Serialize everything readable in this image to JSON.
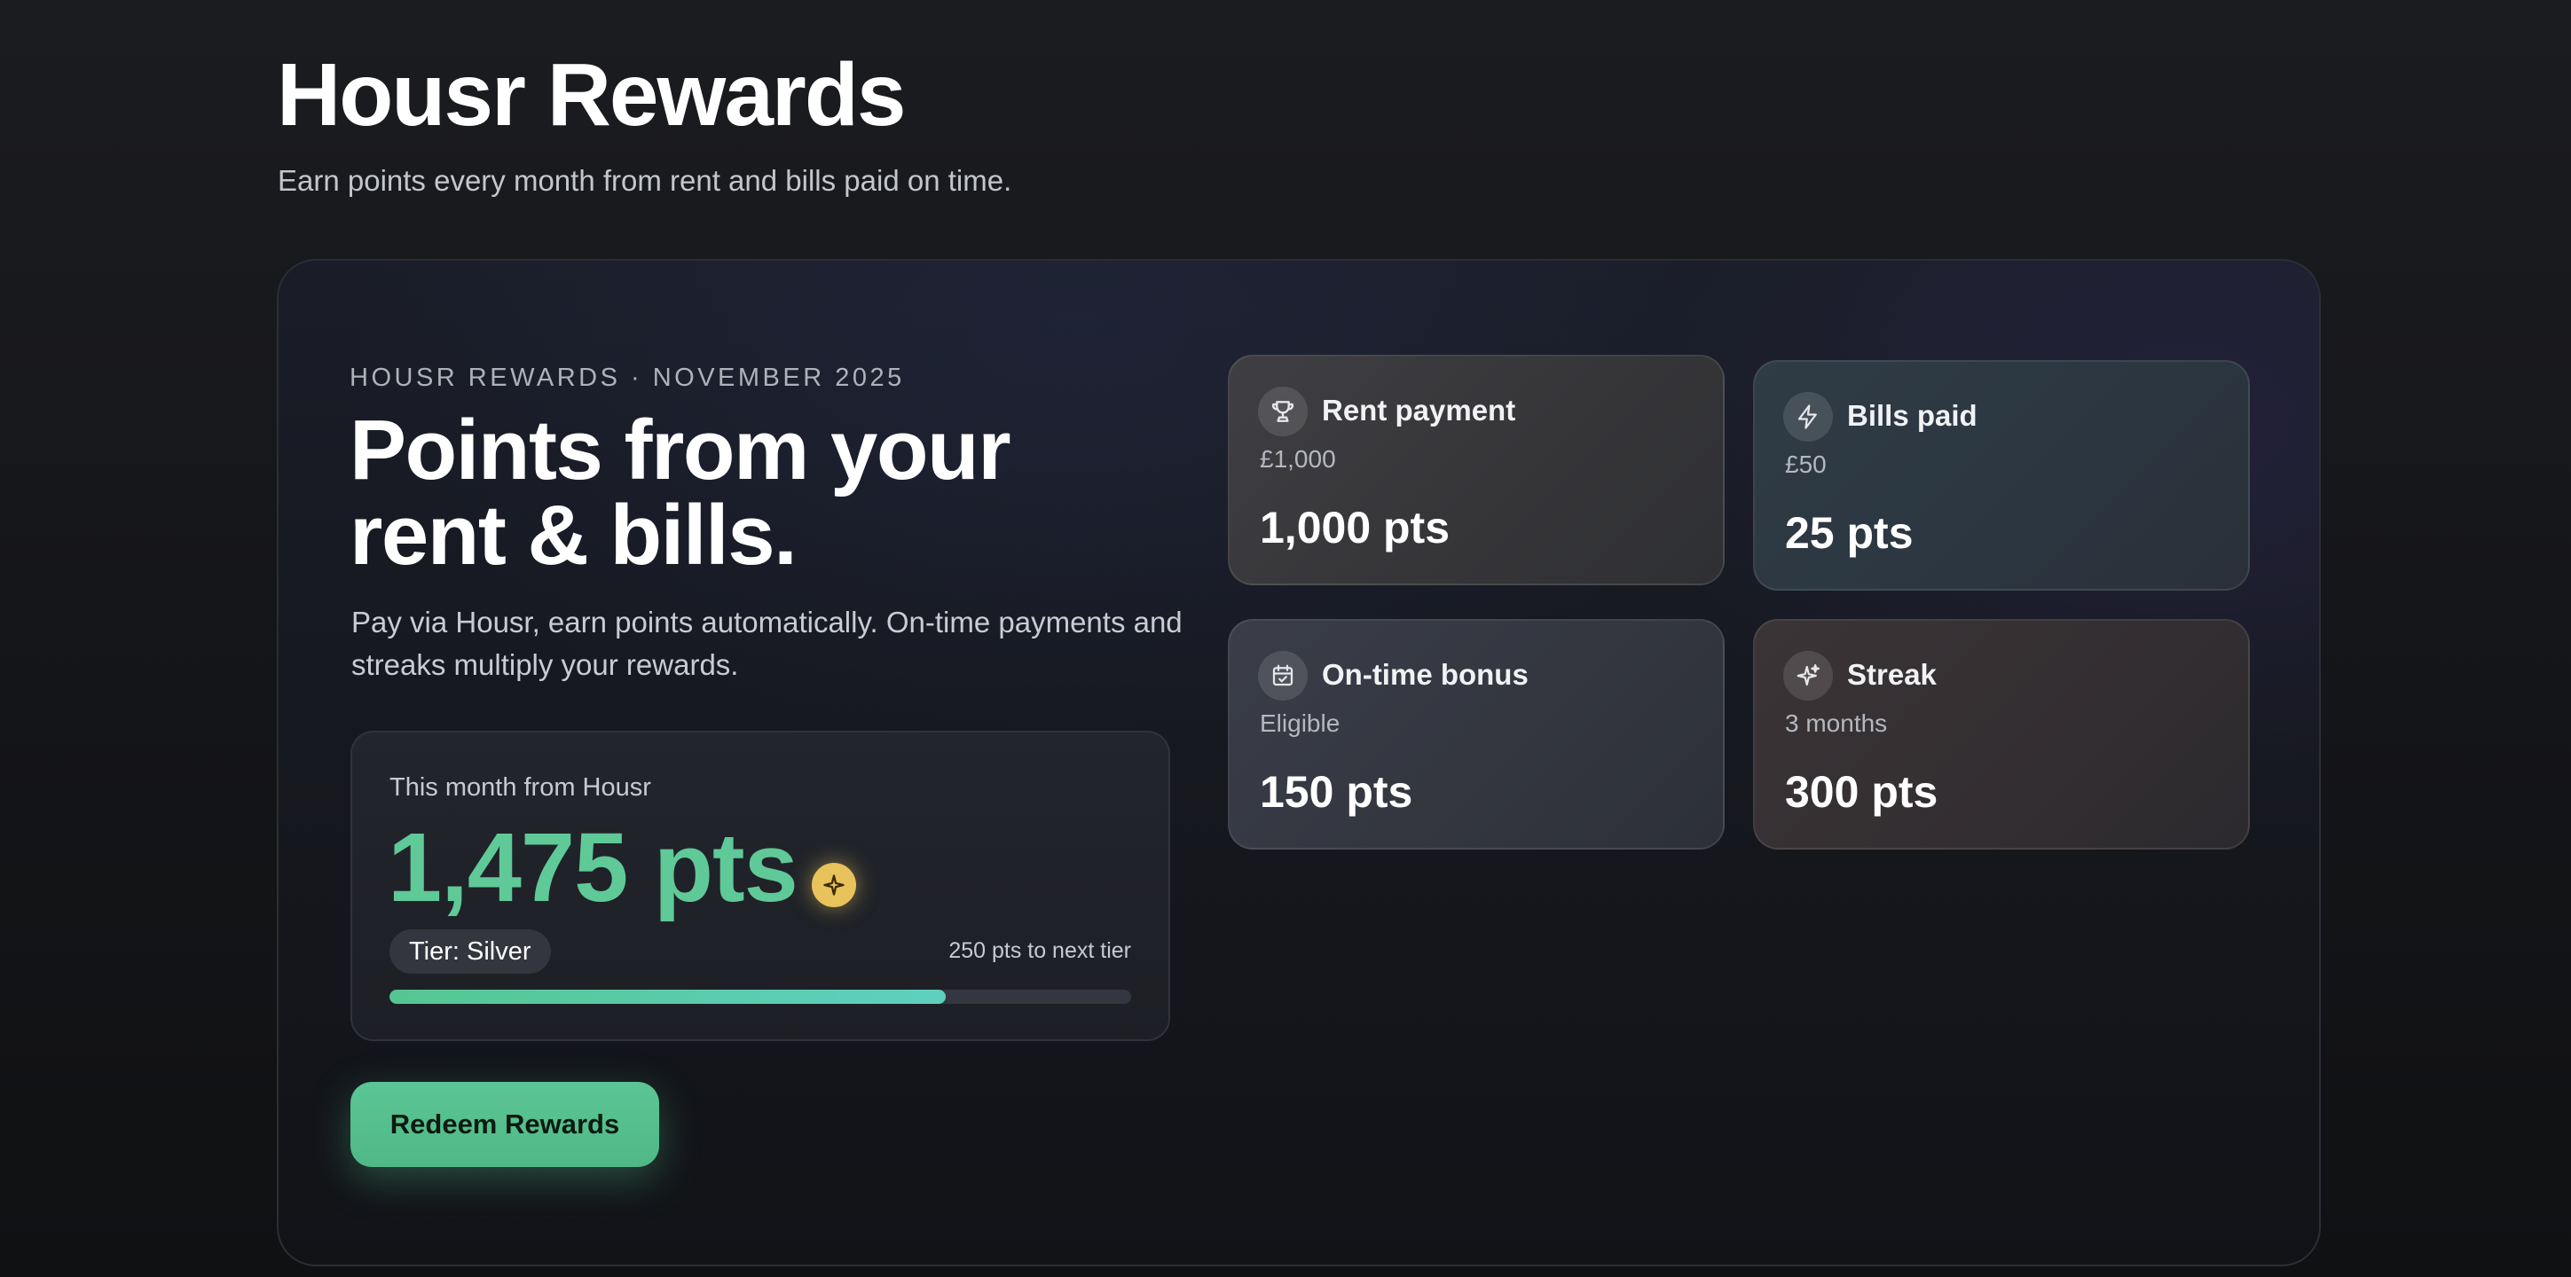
{
  "header": {
    "title": "Housr Rewards",
    "subtitle": "Earn points every month from rent and bills paid on time."
  },
  "hero": {
    "eyebrow": "HOUSR REWARDS · NOVEMBER 2025",
    "title_line1": "Points from your",
    "title_line2": "rent & bills.",
    "description": "Pay via Housr, earn points automatically. On-time payments and streaks multiply your rewards."
  },
  "month_card": {
    "label": "This month from Housr",
    "points": "1,475 pts",
    "tier": "Tier: Silver",
    "next_tier": "250 pts to next tier",
    "progress_fraction": 0.75,
    "progress_color_start": "#55c691",
    "progress_color_end": "#5fd0c0"
  },
  "redeem_button": {
    "label": "Redeem Rewards",
    "color": "#5cc595"
  },
  "stats": [
    {
      "title": "Rent payment",
      "sub": "£1,000",
      "value": "1,000 pts",
      "icon": "trophy-icon"
    },
    {
      "title": "Bills paid",
      "sub": "£50",
      "value": "25 pts",
      "icon": "lightning-icon"
    },
    {
      "title": "On-time bonus",
      "sub": "Eligible",
      "value": "150 pts",
      "icon": "calendar-check-icon"
    },
    {
      "title": "Streak",
      "sub": "3 months",
      "value": "300 pts",
      "icon": "sparkles-icon"
    }
  ],
  "colors": {
    "accent_green": "#5fc997",
    "sparkle_badge": "#e8c25a",
    "background": "#141518"
  }
}
